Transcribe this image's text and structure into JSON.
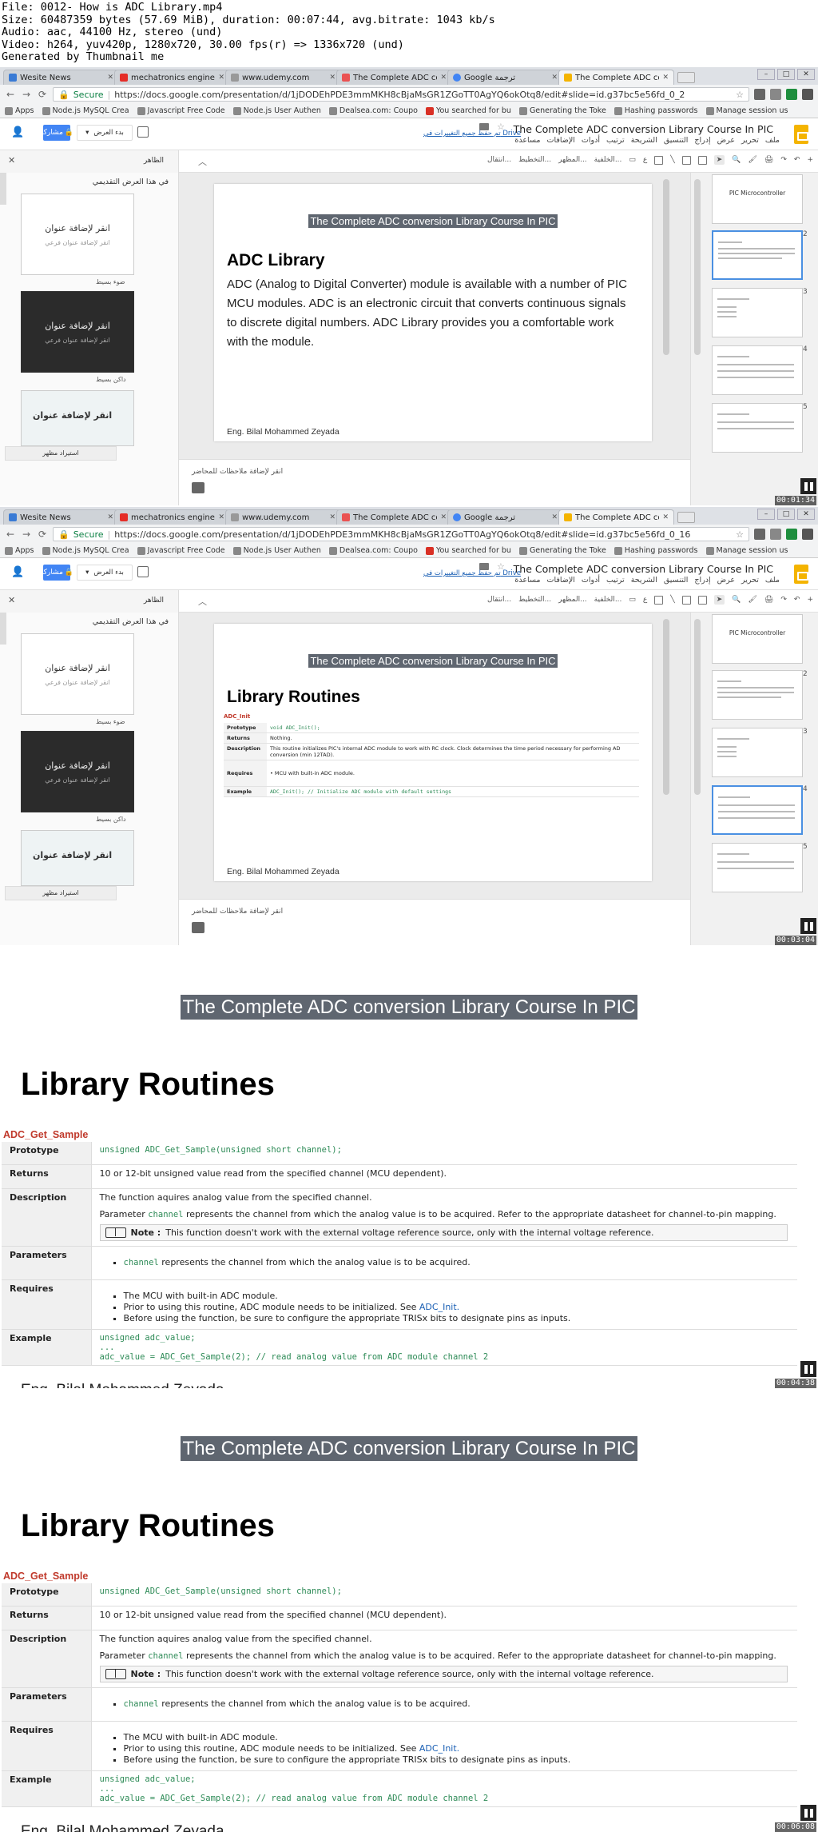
{
  "info_lines": [
    "File: 0012- How is ADC Library.mp4",
    "Size: 60487359 bytes (57.69 MiB), duration: 00:07:44, avg.bitrate: 1043 kb/s",
    "Audio: aac, 44100 Hz, stereo (und)",
    "Video: h264, yuv420p, 1280x720, 30.00 fps(r) => 1336x720 (und)",
    "Generated by Thumbnail me"
  ],
  "browser": {
    "tabs": [
      "Wesite News",
      "mechatronics engineerin",
      "www.udemy.com",
      "The Complete ADC conv",
      "Google ترجمة",
      "The Complete ADC conv"
    ],
    "secure": "Secure",
    "bookmarks": [
      "Apps",
      "Node.js MySQL Crea",
      "Javascript Free Code",
      "Node.js User Authen",
      "Dealsea.com: Coupo",
      "You searched for bu",
      "Generating the Toke",
      "Hashing passwords",
      "Manage session us"
    ]
  },
  "frames": [
    {
      "url": "https://docs.google.com/presentation/d/1jDODEhPDE3mmMKH8cBjaMsGR1ZGoTT0AgYQ6okOtq8/edit#slide=id.g37bc5e56fd_0_2",
      "timestamp": "00:01:34"
    },
    {
      "url": "https://docs.google.com/presentation/d/1jDODEhPDE3mmMKH8cBjaMsGR1ZGoTT0AgYQ6okOtq8/edit#slide=id.g37bc5e56fd_0_16",
      "timestamp": "00:03:04"
    }
  ],
  "slides_app": {
    "doc_title": "The Complete ADC conversion Library Course In PIC",
    "drive_note": "تم حفظ جميع التغييرات في Drive",
    "menu": [
      "ملف",
      "تحرير",
      "عرض",
      "إدراج",
      "التنسيق",
      "الشريحة",
      "ترتيب",
      "أدوات",
      "الإضافات",
      "مساعدة"
    ],
    "share": "مشاركة",
    "present": "بدء العرض",
    "toolbar_items": [
      "انتقال...",
      "التخطيط...",
      "المظهر...",
      "الخلفية..."
    ],
    "panel_title": "الظاهر",
    "panel_head": "في هذا العرض التقديمي",
    "layout_title": "انقر لإضافة عنوان",
    "layout_sub": "انقر لإضافة عنوان فرعي",
    "layout_labels": [
      "ضوء بسيط",
      "داكن بسيط"
    ],
    "import_btn": "استيراد مظهر",
    "notes": "انقر لإضافة ملاحظات للمحاضر",
    "thumb1_title": "PIC Microcontroller"
  },
  "slide_banner": "The Complete ADC conversion Library Course In PIC",
  "slide1": {
    "title": "ADC Library",
    "body": "ADC (Analog to Digital Converter) module is available with a number of PIC MCU modules. ADC is an electronic circuit that converts continuous signals to discrete digital numbers. ADC Library provides you a comfortable work with the module.",
    "author": "Eng. Bilal Mohammed Zeyada"
  },
  "slide2": {
    "title": "Library Routines",
    "routine": "ADC_Init",
    "rows": [
      {
        "k": "Prototype",
        "v": "void ADC_Init();"
      },
      {
        "k": "Returns",
        "v": "Nothing."
      },
      {
        "k": "Description",
        "v": "This routine initializes PIC's internal ADC module to work with RC clock. Clock determines the time period necessary for performing AD conversion (min 12TAD)."
      },
      {
        "k": "Requires",
        "v": "MCU with built-in ADC module."
      },
      {
        "k": "Example",
        "v": "ADC_Init();  // Initialize ADC module with default settings"
      }
    ]
  },
  "big_slide": {
    "title": "Library Routines",
    "routine": "ADC_Get_Sample",
    "prototype_k": "Prototype",
    "prototype_v": "unsigned ADC_Get_Sample(unsigned short channel);",
    "returns_k": "Returns",
    "returns_v": "10 or 12-bit unsigned value read from the specified channel (MCU dependent).",
    "desc_k": "Description",
    "desc_1": "The function aquires analog value from the specified channel.",
    "desc_2a": "Parameter",
    "desc_2b": "channel",
    "desc_2c": "represents the channel from which the analog value is to be acquired. Refer to the appropriate datasheet for channel-to-pin mapping.",
    "note_k": "Note :",
    "note_v": "This function doesn't work with the external voltage reference source, only with the internal voltage reference.",
    "params_k": "Parameters",
    "params_a": "channel",
    "params_b": "represents the channel from which the analog value is to be acquired.",
    "req_k": "Requires",
    "req_1": "The MCU with built-in ADC module.",
    "req_2a": "Prior to using this routine, ADC module needs to be initialized. See",
    "req_2b": "ADC_Init.",
    "req_3": "Before using the function, be sure to configure the appropriate TRISx bits to designate pins as inputs.",
    "ex_k": "Example",
    "ex_1": "unsigned adc_value;",
    "ex_2": "...",
    "ex_3": "adc_value = ADC_Get_Sample(2);    // read analog value from ADC module channel 2",
    "author": "Eng. Bilal Mohammed Zeyada"
  },
  "big_timestamps": [
    "00:04:38",
    "00:06:08"
  ],
  "colors": {
    "banner": "#5f6670",
    "routine": "#c0392b",
    "share": "#4285f4",
    "slides_logo": "#f4b400",
    "code": "#2e8b57"
  }
}
